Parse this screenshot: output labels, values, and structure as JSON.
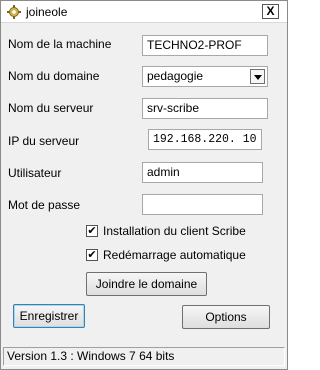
{
  "window": {
    "title": "joineole",
    "close_label": "X",
    "icon": "gear-icon"
  },
  "form": {
    "machine_label": "Nom de la machine",
    "machine_value": "TECHNO2-PROF",
    "domain_label": "Nom du domaine",
    "domain_value": "pedagogie",
    "server_label": "Nom du serveur",
    "server_value": "srv-scribe",
    "ip_label": "IP du serveur",
    "ip_value": "192.168.220. 10",
    "user_label": "Utilisateur",
    "user_value": "admin",
    "password_label": "Mot de passe",
    "password_value": ""
  },
  "options": {
    "install_label": "Installation du client Scribe",
    "install_checked": true,
    "reboot_label": "Redémarrage automatique",
    "reboot_checked": true
  },
  "buttons": {
    "join": "Joindre le domaine",
    "save": "Enregistrer",
    "options": "Options"
  },
  "status": {
    "text": "Version 1.3 : Windows 7 64 bits"
  }
}
